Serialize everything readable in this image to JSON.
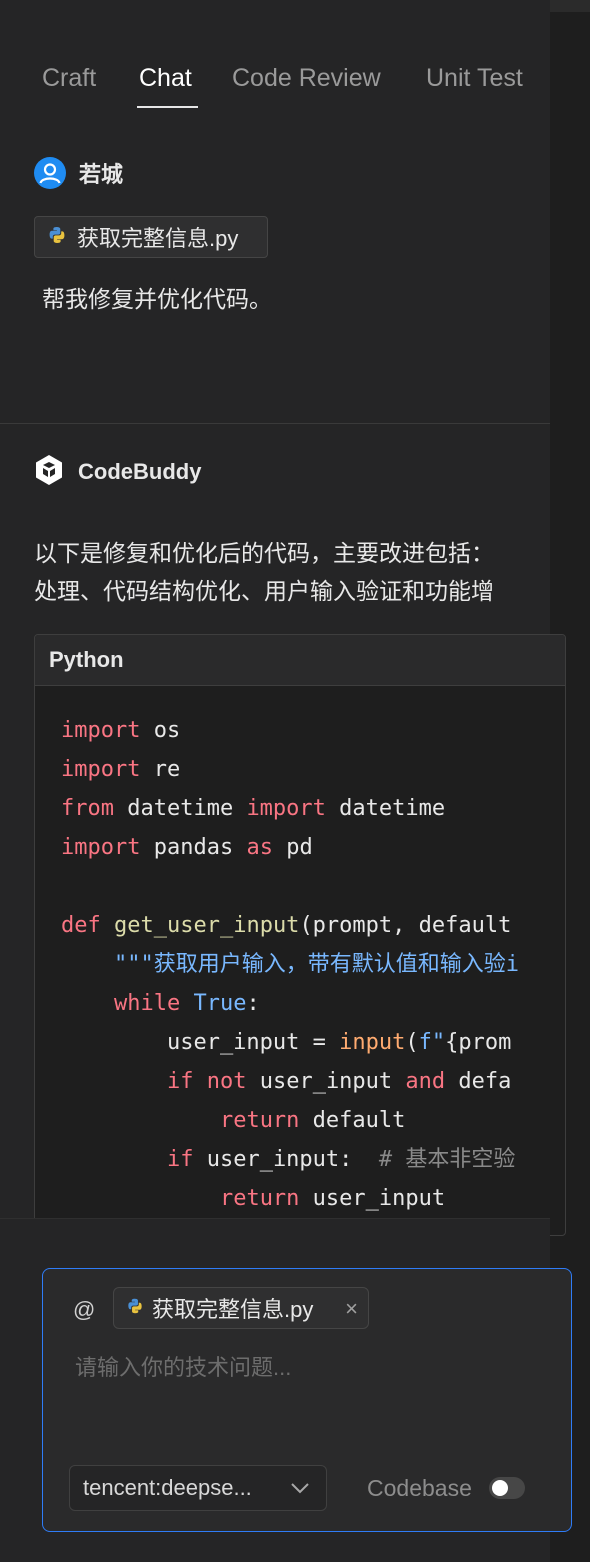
{
  "tabs": [
    {
      "label": "Craft",
      "active": false
    },
    {
      "label": "Chat",
      "active": true
    },
    {
      "label": "Code Review",
      "active": false
    },
    {
      "label": "Unit Test",
      "active": false
    }
  ],
  "user": {
    "name": "若城",
    "attachment": "获取完整信息.py",
    "message": "帮我修复并优化代码。"
  },
  "assistant": {
    "name": "CodeBuddy",
    "intro_line1": "以下是修复和优化后的代码，主要改进包括：",
    "intro_line2": "处理、代码结构优化、用户输入验证和功能增"
  },
  "code_block": {
    "language": "Python",
    "lines": [
      "import os",
      "import re",
      "from datetime import datetime",
      "import pandas as pd",
      "",
      "def get_user_input(prompt, default",
      "    \"\"\"获取用户输入，带有默认值和输入验i",
      "    while True:",
      "        user_input = input(f\"{prom",
      "        if not user_input and defa",
      "            return default",
      "        if user_input:  # 基本非空验",
      "            return user_input"
    ]
  },
  "composer": {
    "at_symbol": "@",
    "context_file": "获取完整信息.py",
    "close_glyph": "×",
    "input_value": "",
    "input_placeholder": "请输入你的技术问题...",
    "model": "tencent:deepse...",
    "codebase_label": "Codebase",
    "codebase_enabled": false
  },
  "colors": {
    "accent": "#2f7cf6",
    "keyword": "#f97583",
    "function": "#dcdcaa",
    "string": "#79b8ff",
    "builtin": "#ffab70"
  },
  "icons": {
    "user_avatar": "user-avatar-icon",
    "python_file": "python-icon",
    "codebuddy_logo": "codebuddy-logo-icon",
    "chevron": "chevron-down-icon"
  }
}
